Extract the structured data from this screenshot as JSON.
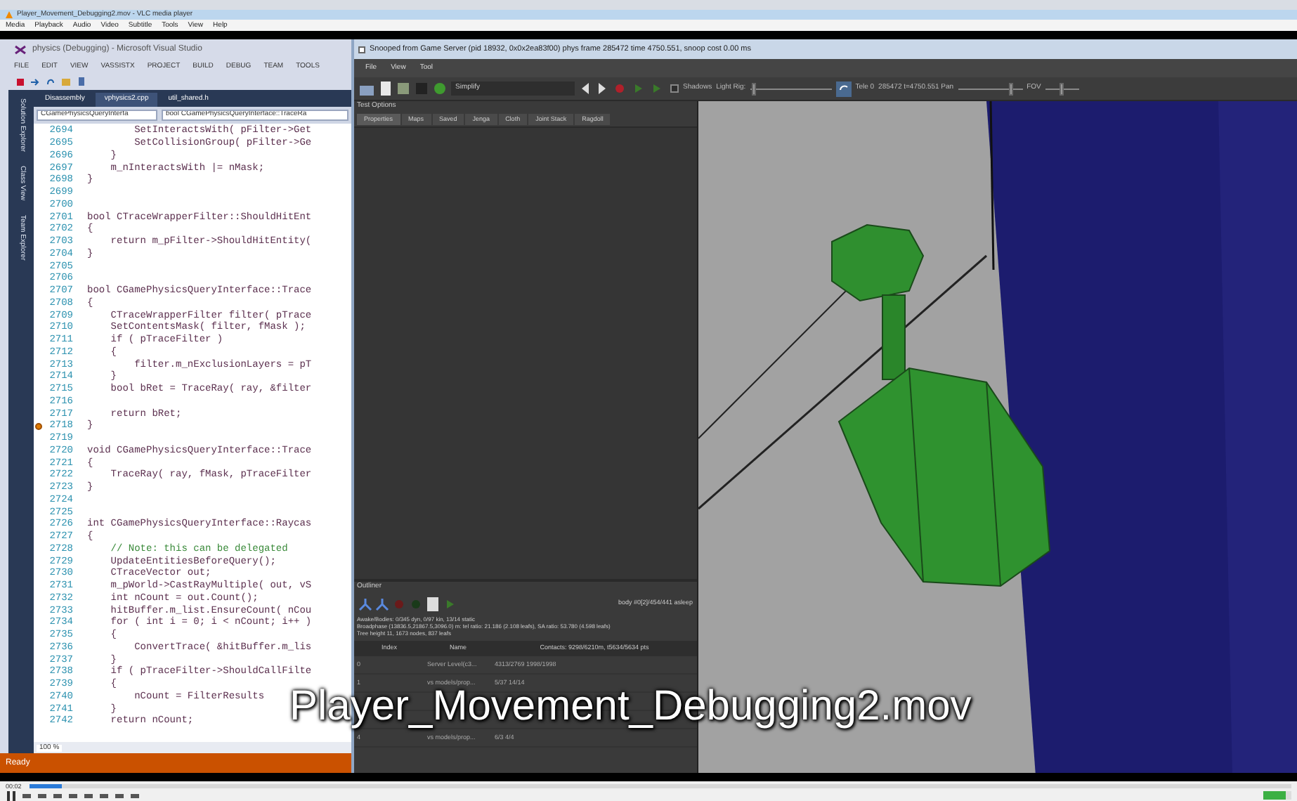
{
  "player": {
    "title": "Player_Movement_Debugging2.mov - VLC media player",
    "menu": [
      "Media",
      "Playback",
      "Audio",
      "Video",
      "Subtitle",
      "Tools",
      "View",
      "Help"
    ],
    "subtitle": "Player_Movement_Debugging2.mov",
    "time": "00:02",
    "seek": {
      "level": 0.025
    },
    "volume": {
      "level": 0.8
    }
  },
  "ide": {
    "title": "physics (Debugging) - Microsoft Visual Studio",
    "menu": [
      "FILE",
      "EDIT",
      "VIEW",
      "VASSISTX",
      "PROJECT",
      "BUILD",
      "DEBUG",
      "TEAM",
      "TOOLS"
    ],
    "side_tabs": [
      "Solution Explorer",
      "Class View",
      "Team Explorer"
    ],
    "tabs": [
      {
        "label": "Disassembly",
        "selected": false
      },
      {
        "label": "vphysics2.cpp",
        "selected": true
      },
      {
        "label": "util_shared.h",
        "selected": false
      }
    ],
    "scope": "CGamePhysicsQueryInterfa",
    "member": "bool CGamePhysicsQueryInterface::TraceRa",
    "lines": [
      {
        "n": "2694",
        "kind": "code",
        "code": "        SetInteractsWith( pFilter->Get"
      },
      {
        "n": "2695",
        "kind": "code",
        "code": "        SetCollisionGroup( pFilter->Ge"
      },
      {
        "n": "2696",
        "kind": "code",
        "code": "    }"
      },
      {
        "n": "2697",
        "kind": "code",
        "code": "    m_nInteractsWith |= nMask;"
      },
      {
        "n": "2698",
        "kind": "code",
        "code": "}"
      },
      {
        "n": "2699",
        "kind": "blank"
      },
      {
        "n": "2700",
        "kind": "blank"
      },
      {
        "n": "2701",
        "kind": "code",
        "code": "bool CTraceWrapperFilter::ShouldHitEnt"
      },
      {
        "n": "2702",
        "kind": "code",
        "code": "{"
      },
      {
        "n": "2703",
        "kind": "code",
        "code": "    return m_pFilter->ShouldHitEntity("
      },
      {
        "n": "2704",
        "kind": "code",
        "code": "}"
      },
      {
        "n": "2705",
        "kind": "blank"
      },
      {
        "n": "2706",
        "kind": "blank"
      },
      {
        "n": "2707",
        "kind": "code",
        "code": "bool CGamePhysicsQueryInterface::Trace"
      },
      {
        "n": "2708",
        "kind": "code",
        "code": "{"
      },
      {
        "n": "2709",
        "kind": "code",
        "code": "    CTraceWrapperFilter filter( pTrace"
      },
      {
        "n": "2710",
        "kind": "code",
        "code": "    SetContentsMask( filter, fMask );"
      },
      {
        "n": "2711",
        "kind": "code",
        "code": "    if ( pTraceFilter )"
      },
      {
        "n": "2712",
        "kind": "code",
        "code": "    {"
      },
      {
        "n": "2713",
        "kind": "code",
        "code": "        filter.m_nExclusionLayers = pT"
      },
      {
        "n": "2714",
        "kind": "code",
        "code": "    }"
      },
      {
        "n": "2715",
        "kind": "code",
        "code": "    bool bRet = TraceRay( ray, &filter"
      },
      {
        "n": "2716",
        "kind": "blank"
      },
      {
        "n": "2717",
        "kind": "code",
        "code": "    return bRet;"
      },
      {
        "n": "2718",
        "kind": "code",
        "code": "}",
        "breakpoint": true
      },
      {
        "n": "2719",
        "kind": "blank"
      },
      {
        "n": "2720",
        "kind": "code",
        "code": "void CGamePhysicsQueryInterface::Trace"
      },
      {
        "n": "2721",
        "kind": "code",
        "code": "{"
      },
      {
        "n": "2722",
        "kind": "code",
        "code": "    TraceRay( ray, fMask, pTraceFilter"
      },
      {
        "n": "2723",
        "kind": "code",
        "code": "}"
      },
      {
        "n": "2724",
        "kind": "blank"
      },
      {
        "n": "2725",
        "kind": "blank"
      },
      {
        "n": "2726",
        "kind": "code",
        "code": "int CGamePhysicsQueryInterface::Raycas"
      },
      {
        "n": "2727",
        "kind": "code",
        "code": "{"
      },
      {
        "n": "2728",
        "kind": "comment",
        "code": "    // Note: this can be delegated"
      },
      {
        "n": "2729",
        "kind": "code",
        "code": "    UpdateEntitiesBeforeQuery();"
      },
      {
        "n": "2730",
        "kind": "code",
        "code": "    CTraceVector out;"
      },
      {
        "n": "2731",
        "kind": "code",
        "code": "    m_pWorld->CastRayMultiple( out, vS"
      },
      {
        "n": "2732",
        "kind": "code",
        "code": "    int nCount = out.Count();"
      },
      {
        "n": "2733",
        "kind": "code",
        "code": "    hitBuffer.m_list.EnsureCount( nCou"
      },
      {
        "n": "2734",
        "kind": "code",
        "code": "    for ( int i = 0; i < nCount; i++ )"
      },
      {
        "n": "2735",
        "kind": "code",
        "code": "    {"
      },
      {
        "n": "2736",
        "kind": "code",
        "code": "        ConvertTrace( &hitBuffer.m_lis"
      },
      {
        "n": "2737",
        "kind": "code",
        "code": "    }"
      },
      {
        "n": "2738",
        "kind": "code",
        "code": "    if ( pTraceFilter->ShouldCallFilte"
      },
      {
        "n": "2739",
        "kind": "code",
        "code": "    {"
      },
      {
        "n": "2740",
        "kind": "code",
        "code": "        nCount = FilterResults"
      },
      {
        "n": "2741",
        "kind": "code",
        "code": "    }"
      },
      {
        "n": "2742",
        "kind": "code",
        "code": "    return nCount;"
      }
    ],
    "zoom": "100 %",
    "status": "Ready"
  },
  "tool": {
    "title": "Snooped from Game Server (pid 18932, 0x0x2ea83f00) phys frame 285472 time 4750.551, snoop cost 0.00 ms",
    "menu": [
      "File",
      "View",
      "Tool"
    ],
    "mode": "Simplify",
    "shadows": {
      "label": "Shadows",
      "checked": false
    },
    "light_rig": {
      "label": "Light Rig:",
      "level": 0.02
    },
    "tele": "Tele 0",
    "frame": "285472 t=4750.551 Pan",
    "pan": {
      "level": 0.85
    },
    "fov": {
      "label": "FOV",
      "level": 0.5
    },
    "panel_title": "Test Options",
    "tabs": [
      {
        "label": "Properties",
        "selected": true
      },
      {
        "label": "Maps",
        "selected": false
      },
      {
        "label": "Saved",
        "selected": false
      },
      {
        "label": "Jenga",
        "selected": false
      },
      {
        "label": "Cloth",
        "selected": false
      },
      {
        "label": "Joint Stack",
        "selected": false
      },
      {
        "label": "Ragdoll",
        "selected": false
      }
    ],
    "outliner": {
      "title": "Outliner",
      "body": "body #0[2]/454/441 asleep",
      "stats": [
        "Awake/Bodies: 0/345 dyn, 0/97 kin, 13/14 static",
        "Broadphase (13836.5,21867.5,3096.0) m: tel ratio: 21.186 (2.108 leafs), SA ratio: 53.780 (4.598 leafs)",
        "Tree height 11, 1673 nodes, 837 leafs"
      ],
      "columns": [
        "Index",
        "Name",
        "Contacts: 9298/6210m, t5634/5634 pts"
      ],
      "rows": [
        {
          "index": "0",
          "name": "Server Level(c3...",
          "contacts": "4313/2769 1998/1998"
        },
        {
          "index": "1",
          "name": "vs models/prop...",
          "contacts": "5/37 14/14"
        },
        {},
        {},
        {
          "index": "4",
          "name": "vs models/prop...",
          "contacts": "6/3 4/4"
        }
      ]
    }
  }
}
